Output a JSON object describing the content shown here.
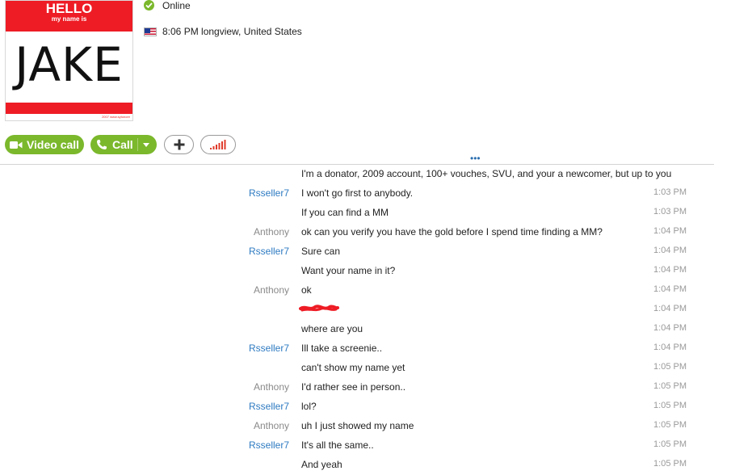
{
  "profile": {
    "avatar_top": "HELLO",
    "avatar_sub": "my name is",
    "avatar_name": "JAKE",
    "avatar_copy": "2007 www.sytonore",
    "status": "Online",
    "location": "8:06 PM longview, United States"
  },
  "toolbar": {
    "video_call": "Video call",
    "call": "Call"
  },
  "colors": {
    "accent_green": "#7bb82c",
    "sender_me": "#2e7bc2",
    "sender_them": "#8a8a8a",
    "redaction": "#ee1c25"
  },
  "messages": [
    {
      "sender": "",
      "side": "me",
      "text": "I'm a donator, 2009 account, 100+ vouches, SVU, and your a newcomer, but up to you",
      "time": ""
    },
    {
      "sender": "Rsseller7",
      "side": "me",
      "text": "I won't go first to anybody.",
      "time": "1:03 PM"
    },
    {
      "sender": "",
      "side": "me",
      "text": "If you can find a MM",
      "time": "1:03 PM"
    },
    {
      "sender": "Anthony",
      "side": "them",
      "text": "ok can you verify you have the gold before I spend time finding a MM?",
      "time": "1:04 PM"
    },
    {
      "sender": "Rsseller7",
      "side": "me",
      "text": "Sure can",
      "time": "1:04 PM"
    },
    {
      "sender": "",
      "side": "me",
      "text": "Want your name in it?",
      "time": "1:04 PM"
    },
    {
      "sender": "Anthony",
      "side": "them",
      "text": "ok",
      "time": "1:04 PM"
    },
    {
      "sender": "",
      "side": "them",
      "text": "",
      "time": "1:04 PM",
      "redacted": true
    },
    {
      "sender": "",
      "side": "them",
      "text": "where are you",
      "time": "1:04 PM"
    },
    {
      "sender": "Rsseller7",
      "side": "me",
      "text": "Ill take a screenie..",
      "time": "1:04 PM"
    },
    {
      "sender": "",
      "side": "me",
      "text": "can't show my name yet",
      "time": "1:05 PM"
    },
    {
      "sender": "Anthony",
      "side": "them",
      "text": "I'd rather see in person..",
      "time": "1:05 PM"
    },
    {
      "sender": "Rsseller7",
      "side": "me",
      "text": "lol?",
      "time": "1:05 PM"
    },
    {
      "sender": "Anthony",
      "side": "them",
      "text": "uh I just showed my name",
      "time": "1:05 PM"
    },
    {
      "sender": "Rsseller7",
      "side": "me",
      "text": "It's all the same..",
      "time": "1:05 PM"
    },
    {
      "sender": "",
      "side": "me",
      "text": "And yeah",
      "time": "1:05 PM"
    }
  ]
}
